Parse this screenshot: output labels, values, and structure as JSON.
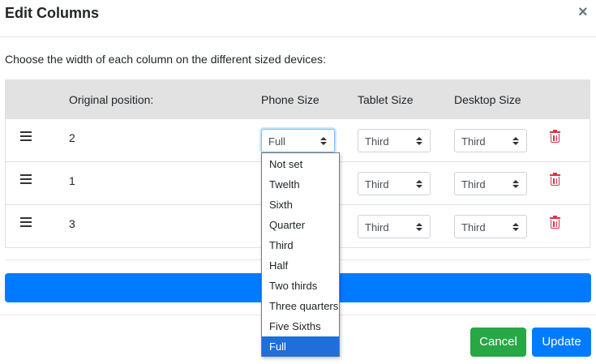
{
  "modal": {
    "title": "Edit Columns",
    "close_symbol": "×"
  },
  "instructions": "Choose the width of each column on the different sized devices:",
  "table": {
    "headers": [
      "",
      "Original position:",
      "Phone Size",
      "Tablet Size",
      "Desktop Size",
      ""
    ],
    "rows": [
      {
        "position": "2",
        "phone": "Full",
        "tablet": "Third",
        "desktop": "Third"
      },
      {
        "position": "1",
        "phone": "",
        "tablet": "Third",
        "desktop": "Third"
      },
      {
        "position": "3",
        "phone": "",
        "tablet": "Third",
        "desktop": "Third"
      }
    ]
  },
  "phone_dropdown": {
    "options": [
      "Not set",
      "Twelth",
      "Sixth",
      "Quarter",
      "Third",
      "Half",
      "Two thirds",
      "Three quarters",
      "Five Sixths",
      "Full"
    ],
    "selected": "Full"
  },
  "add_button": {
    "label": ""
  },
  "footer": {
    "cancel_label": "Cancel",
    "update_label": "Update"
  },
  "colors": {
    "primary": "#007bff",
    "success": "#28a745",
    "danger": "#dc3545",
    "header_bg": "#e2e2e2",
    "option_selected": "#1e6fd9"
  },
  "icons": {
    "handle": "bars-icon",
    "delete": "trash-icon",
    "close": "close-icon"
  }
}
